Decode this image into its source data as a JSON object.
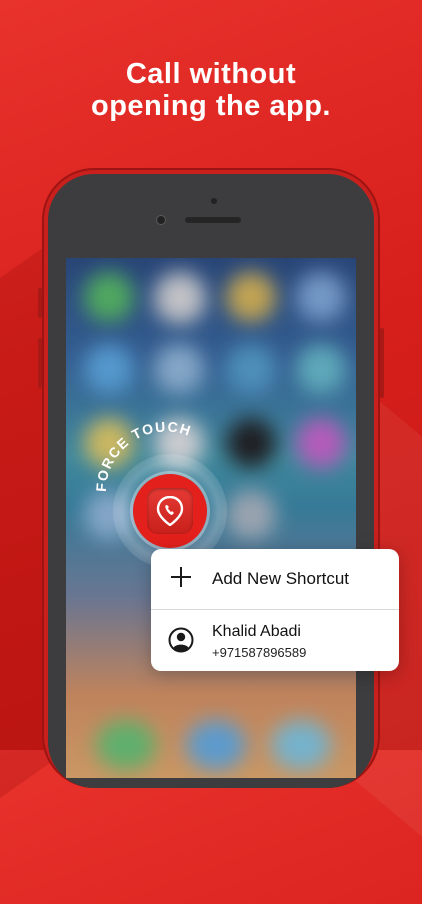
{
  "headline": {
    "line1": "Call without",
    "line2": "opening the app."
  },
  "force_touch_label": "FORCE TOUCH",
  "shortcut_menu": {
    "add_label": "Add New Shortcut",
    "contact_name": "Khalid Abadi",
    "contact_phone": "+971587896589"
  },
  "colors": {
    "brand_red": "#e3201c",
    "menu_bg": "#ffffff"
  },
  "icons": {
    "add": "plus-icon",
    "contact": "person-circle-icon",
    "app": "phone-pin-icon"
  }
}
